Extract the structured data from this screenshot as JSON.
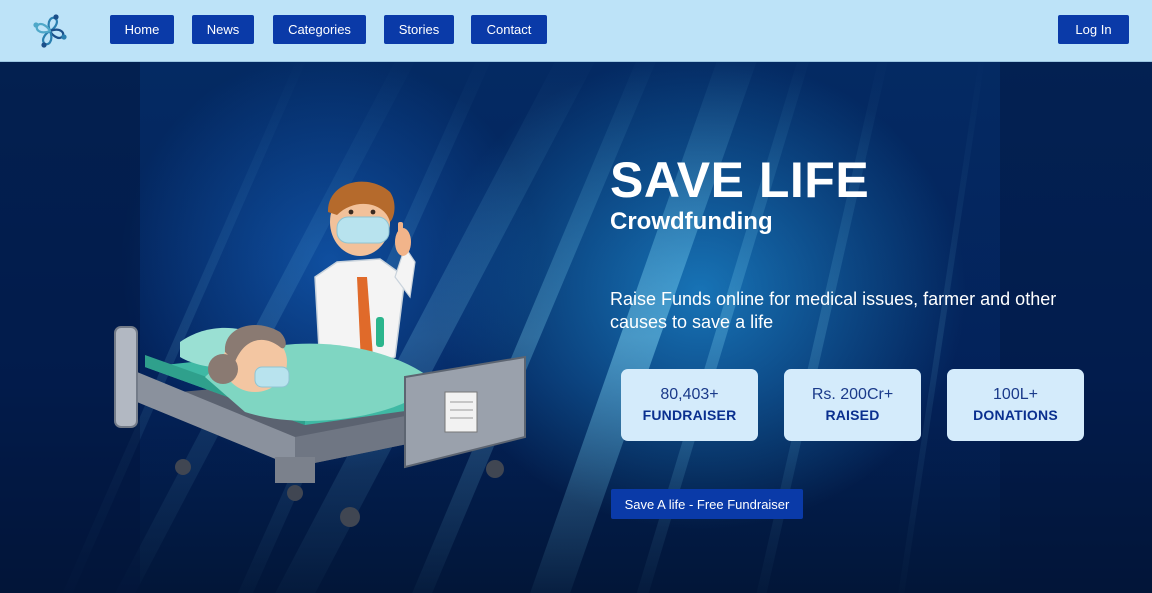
{
  "nav": {
    "logo_icon": "flower-people-logo",
    "items": [
      {
        "label": "Home"
      },
      {
        "label": "News"
      },
      {
        "label": "Categories"
      },
      {
        "label": "Stories"
      },
      {
        "label": "Contact"
      }
    ],
    "login_label": "Log In"
  },
  "hero": {
    "title": "SAVE LIFE",
    "subtitle": "Crowdfunding",
    "description": "Raise Funds online for medical issues, farmer and other causes to save a life",
    "stats": [
      {
        "value": "80,403+",
        "label": "FUNDRAISER"
      },
      {
        "value": "Rs. 200Cr+",
        "label": "RAISED"
      },
      {
        "value": "100L+",
        "label": "DONATIONS"
      }
    ],
    "cta_label": "Save A life - Free Fundraiser",
    "illustration": "doctor-with-patient-in-hospital-bed"
  },
  "colors": {
    "nav_bg": "#bde3f8",
    "button_bg": "#0a3aa8",
    "hero_bg": "#03225a",
    "card_bg": "#d4ebfb",
    "card_text": "#0a2f8f"
  }
}
